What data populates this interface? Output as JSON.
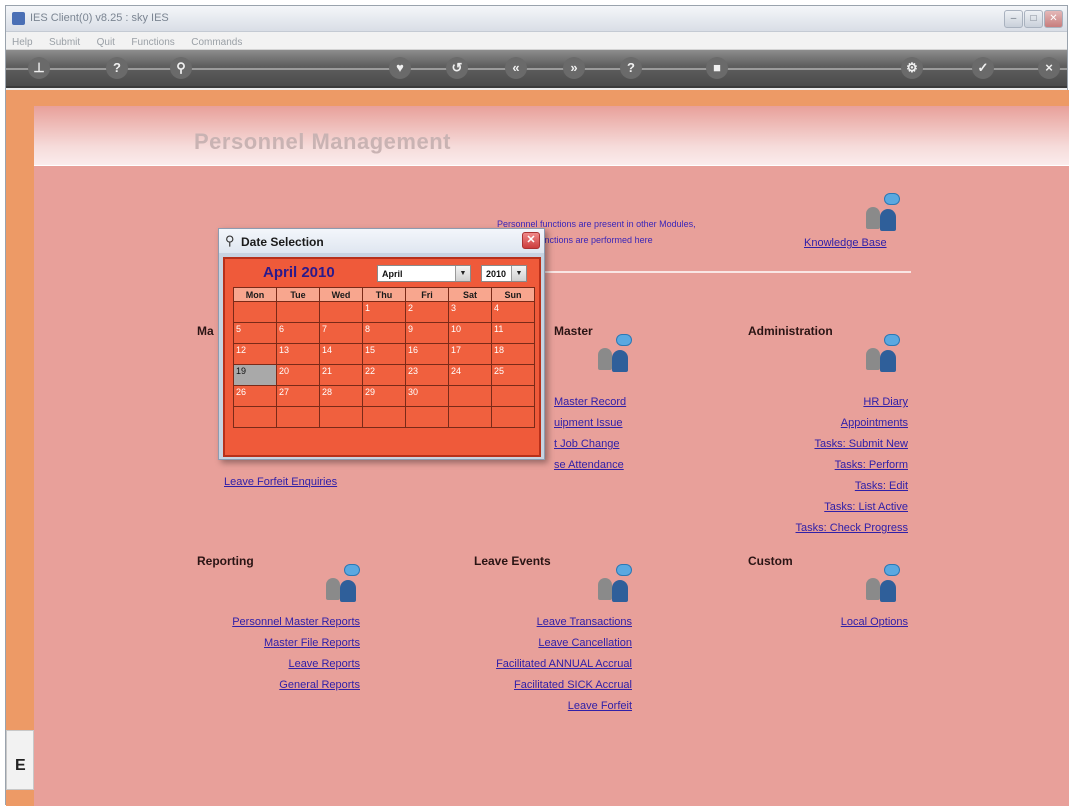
{
  "window": {
    "title": "IES Client(0) v8.25 : sky IES"
  },
  "menu": [
    "Help",
    "Submit",
    "Quit",
    "Functions",
    "Commands"
  ],
  "toolbar_icons": [
    "key-icon",
    "help-icon",
    "search-icon",
    "heart-icon",
    "undo-icon",
    "previous-icon",
    "next-icon",
    "info-icon",
    "stop-icon",
    "settings-icon",
    "ok-icon",
    "close-icon"
  ],
  "page": {
    "title": "Personnel Management",
    "note_line1": "Personnel functions are present in other Modules,",
    "note_line2": "re central functions are performed here",
    "knowledge_base": "Knowledge Base"
  },
  "sections": {
    "ma_title": "Ma",
    "ma_links": [
      "Leave Forfeit Enquiries"
    ],
    "master_title": "Master",
    "master_links": [
      "Master Record",
      "uipment Issue",
      "t Job Change",
      "se Attendance"
    ],
    "administration_title": "Administration",
    "administration_links": [
      "HR Diary",
      "Appointments",
      "Tasks: Submit New",
      "Tasks: Perform",
      "Tasks: Edit",
      "Tasks: List Active",
      "Tasks: Check Progress"
    ],
    "reporting_title": "Reporting",
    "reporting_links": [
      "Personnel Master Reports",
      "Master File Reports",
      "Leave Reports",
      "General Reports"
    ],
    "leave_events_title": "Leave Events",
    "leave_events_links": [
      "Leave Transactions",
      "Leave Cancellation",
      "Facilitated ANNUAL Accrual",
      "Facilitated SICK Accrual",
      "Leave Forfeit"
    ],
    "custom_title": "Custom",
    "custom_links": [
      "Local Options"
    ]
  },
  "status": {
    "left_label": "E"
  },
  "dialog": {
    "title": "Date Selection",
    "month_label": "April 2010",
    "month_select": "April",
    "year_select": "2010",
    "weekdays": [
      "Mon",
      "Tue",
      "Wed",
      "Thu",
      "Fri",
      "Sat",
      "Sun"
    ],
    "weeks": [
      [
        "",
        "",
        "",
        "1",
        "2",
        "3",
        "4"
      ],
      [
        "5",
        "6",
        "7",
        "8",
        "9",
        "10",
        "11"
      ],
      [
        "12",
        "13",
        "14",
        "15",
        "16",
        "17",
        "18"
      ],
      [
        "19",
        "20",
        "21",
        "22",
        "23",
        "24",
        "25"
      ],
      [
        "26",
        "27",
        "28",
        "29",
        "30",
        "",
        ""
      ],
      [
        "",
        "",
        "",
        "",
        "",
        "",
        ""
      ]
    ],
    "selected_day": "19"
  }
}
